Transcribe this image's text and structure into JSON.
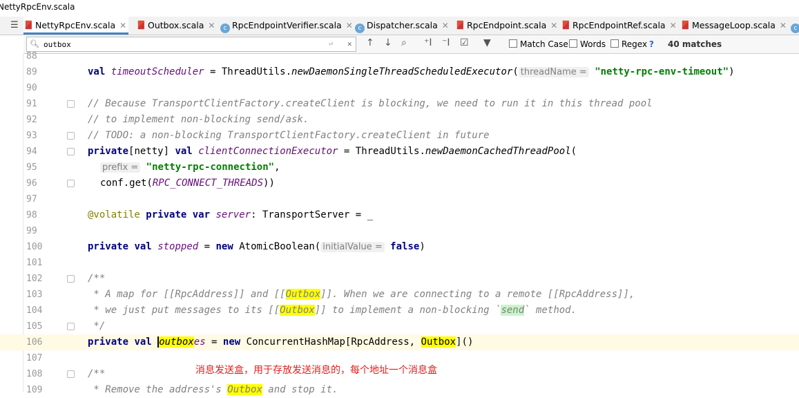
{
  "window": {
    "title": "NettyRpcEnv.scala"
  },
  "tabs": [
    {
      "label": "NettyRpcEnv.scala",
      "icon": "scala-file-icon",
      "active": true
    },
    {
      "label": "Outbox.scala",
      "icon": "scala-file-icon",
      "active": false
    },
    {
      "label": "RpcEndpointVerifier.scala",
      "icon": "class-icon",
      "active": false
    },
    {
      "label": "Dispatcher.scala",
      "icon": "class-icon",
      "active": false
    },
    {
      "label": "RpcEndpoint.scala",
      "icon": "scala-file-icon",
      "active": false
    },
    {
      "label": "RpcEndpointRef.scala",
      "icon": "scala-file-icon",
      "active": false
    },
    {
      "label": "MessageLoop.scala",
      "icon": "scala-file-icon",
      "active": false
    }
  ],
  "search": {
    "query": "outbox",
    "options": {
      "match_case": "Match Case",
      "words": "Words",
      "regex": "Regex",
      "help": "?"
    },
    "matches": "40 matches"
  },
  "line_numbers": [
    "88",
    "89",
    "90",
    "91",
    "92",
    "93",
    "94",
    "95",
    "96",
    "97",
    "98",
    "99",
    "100",
    "101",
    "102",
    "103",
    "104",
    "105",
    "106",
    "107",
    "108",
    "109"
  ],
  "code": {
    "l89": {
      "kw": "val",
      "name": "timeoutScheduler",
      "eq": " = ThreadUtils.",
      "fn": "newDaemonSingleThreadScheduledExecutor",
      "open": "(",
      "hint": "threadName =",
      "str": "\"netty-rpc-env-timeout\"",
      "close": ")"
    },
    "l91": "// Because TransportClientFactory.createClient is blocking, we need to run it in this thread pool",
    "l92": "// to implement non-blocking send/ask.",
    "l93": "// TODO: a non-blocking TransportClientFactory.createClient in future",
    "l94": {
      "kw1": "private",
      "mid": "[netty] ",
      "kw2": "val",
      "name": "clientConnectionExecutor",
      "eq": " = ThreadUtils.",
      "fn": "newDaemonCachedThreadPool",
      "open": "("
    },
    "l95": {
      "hint": "prefix =",
      "str": "\"netty-rpc-connection\"",
      "tail": ","
    },
    "l96": {
      "pre": "conf.get(",
      "const": "RPC_CONNECT_THREADS",
      "post": "))"
    },
    "l98": {
      "ann": "@volatile",
      "kw1": "private",
      "kw2": "var",
      "name": "server",
      "rest": ": TransportServer = _"
    },
    "l100": {
      "kw1": "private",
      "kw2": "val",
      "name": "stopped",
      "eq": " = ",
      "kw3": "new",
      "cls": " AtomicBoolean(",
      "hint": "initialValue =",
      "val": "false",
      "close": ")"
    },
    "l102": "/**",
    "l103": {
      "a": " * A map for [[RpcAddress]] and [[",
      "hl": "Outbox",
      "b": "]]. When we are connecting to a remote [[RpcAddress]],"
    },
    "l104": {
      "a": " * we just put messages to its [[",
      "hl": "Outbox",
      "b": "]] to implement a non-blocking `",
      "bq": "send",
      "c": "` method."
    },
    "l105": " */",
    "l106": {
      "kw1": "private",
      "kw2": "val",
      "hl": "outbox",
      "name": "es",
      "eq": " = ",
      "kw3": "new",
      "cls": " ConcurrentHashMap[RpcAddress, ",
      "hl2": "Outbox",
      "close": "]()"
    },
    "l108": "/**",
    "l109": {
      "a": " * Remove the address's ",
      "hl": "Outbox",
      "b": " and stop it."
    }
  },
  "annotation_note": "消息发送盒，用于存放发送消息的，每个地址一个消息盒"
}
